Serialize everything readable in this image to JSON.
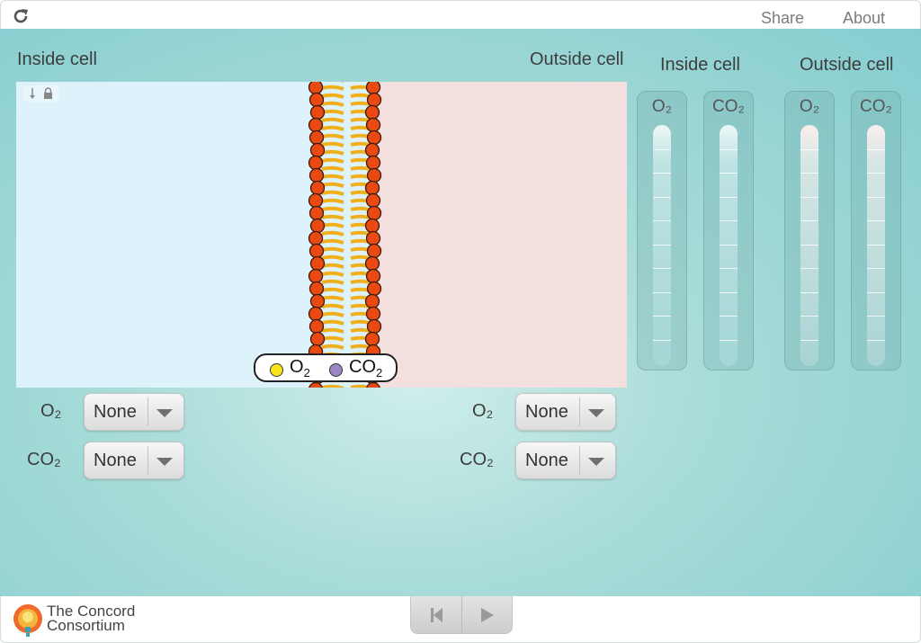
{
  "topbar": {
    "share_label": "Share",
    "about_label": "About"
  },
  "headers": {
    "inside_cell": "Inside cell",
    "outside_cell": "Outside cell",
    "gauge_inside": "Inside cell",
    "gauge_outside": "Outside cell"
  },
  "legend": {
    "o2_label": "O",
    "o2_sub": "2",
    "co2_label": "CO",
    "co2_sub": "2",
    "o2_color": "#f6e51a",
    "co2_color": "#9a86c2"
  },
  "controls": {
    "inside_o2_label": "O₂",
    "inside_co2_label": "CO₂",
    "outside_o2_label": "O₂",
    "outside_co2_label": "CO₂",
    "inside_o2_value": "None",
    "inside_co2_value": "None",
    "outside_o2_value": "None",
    "outside_co2_value": "None"
  },
  "gauges": {
    "inside_o2_label": "O₂",
    "inside_co2_label": "CO₂",
    "outside_o2_label": "O₂",
    "outside_co2_label": "CO₂"
  },
  "footer": {
    "logo_line1": "The Concord",
    "logo_line2": "Consortium"
  },
  "colors": {
    "phospholipid_head": "#e84a12",
    "phospholipid_tail": "#f0b01e"
  }
}
